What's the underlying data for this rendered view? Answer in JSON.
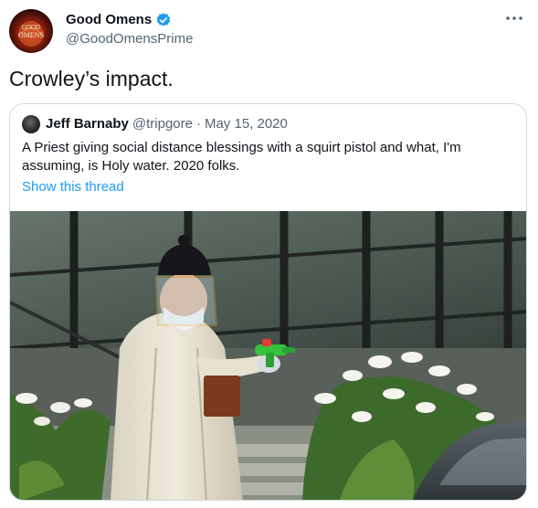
{
  "author": {
    "display_name": "Good Omens",
    "handle": "@GoodOmensPrime",
    "avatar_text": [
      "GOOD",
      "OMENS"
    ],
    "verified": true,
    "verified_icon": "verified-badge-icon",
    "more_icon": "more-horizontal-icon"
  },
  "tweet": {
    "text": "Crowley’s impact."
  },
  "quoted": {
    "display_name": "Jeff Barnaby",
    "handle": "@tripgore",
    "separator": "·",
    "date": "May 15, 2020",
    "text": "A Priest giving social distance blessings with a squirt pistol and what, I'm assuming, is Holy water. 2020 folks.",
    "thread_link": "Show this thread",
    "media_icon": "photo"
  },
  "colors": {
    "link": "#1d9bf0",
    "verified": "#1d9bf0",
    "secondary_text": "#536471",
    "border": "#cfd9de"
  }
}
